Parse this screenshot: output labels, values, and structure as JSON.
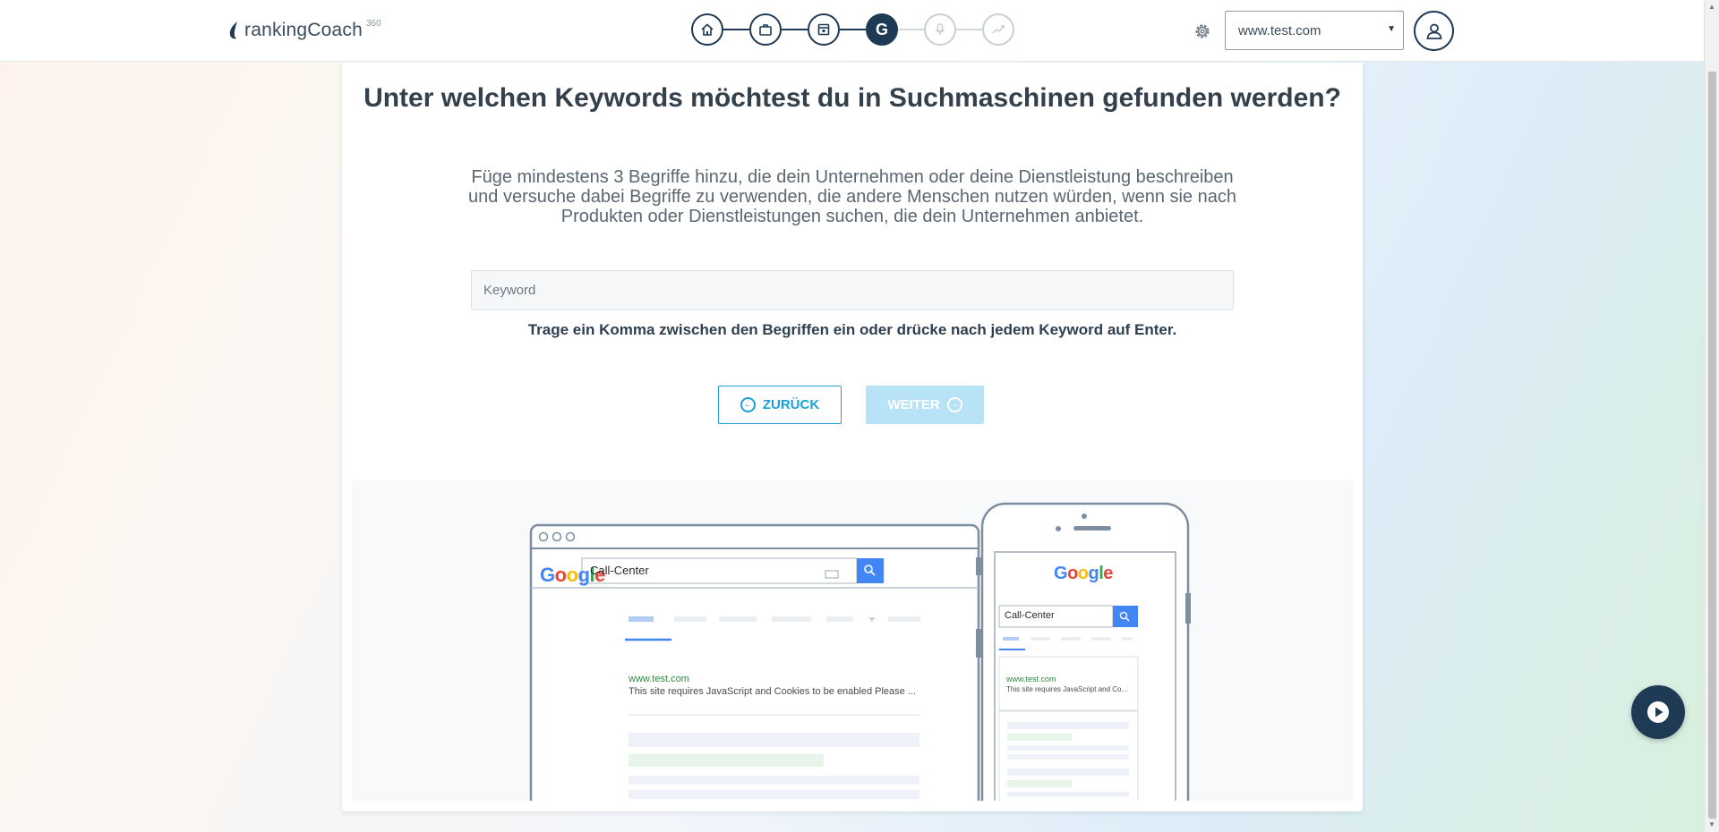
{
  "header": {
    "logo_text": "rankingCoach",
    "logo_sup": "360",
    "website_select": "www.test.com"
  },
  "stepper": {
    "steps": [
      {
        "name": "home",
        "state": "done"
      },
      {
        "name": "business",
        "state": "done"
      },
      {
        "name": "location",
        "state": "done"
      },
      {
        "name": "google",
        "state": "active",
        "label": "G"
      },
      {
        "name": "voice",
        "state": "future"
      },
      {
        "name": "analytics",
        "state": "future"
      }
    ]
  },
  "main": {
    "title": "Unter welchen Keywords möchtest du in Suchmaschinen gefunden werden?",
    "subtitle": "Füge mindestens 3 Begriffe hinzu, die dein Unternehmen oder deine Dienstleistung beschreiben und versuche dabei Begriffe zu verwenden, die andere Menschen nutzen würden, wenn sie nach Produkten oder Dienstleistungen suchen, die dein Unternehmen anbietet.",
    "keyword_placeholder": "Keyword",
    "keyword_value": "",
    "hint": "Trage ein Komma zwischen den Begriffen ein oder drücke nach jedem Keyword auf Enter.",
    "back_label": "ZURÜCK",
    "next_label": "WEITER"
  },
  "illustration": {
    "desktop": {
      "google_logo": "Google",
      "search_query": "Call-Center",
      "result_url": "www.test.com",
      "result_snippet": "This site requires JavaScript and Cookies to be enabled Please ..."
    },
    "mobile": {
      "google_logo": "Google",
      "search_query": "Call-Center",
      "result_url": "www.test.com",
      "result_snippet": "This site requires JavaScript and Co..."
    }
  },
  "colors": {
    "primary_dark": "#1f3a55",
    "accent_blue": "#1b9fd9",
    "disabled_blue": "#b8e2f5",
    "google_blue": "#4285f4",
    "google_red": "#ea4335",
    "google_yellow": "#fbbc05",
    "google_green": "#34a853"
  }
}
